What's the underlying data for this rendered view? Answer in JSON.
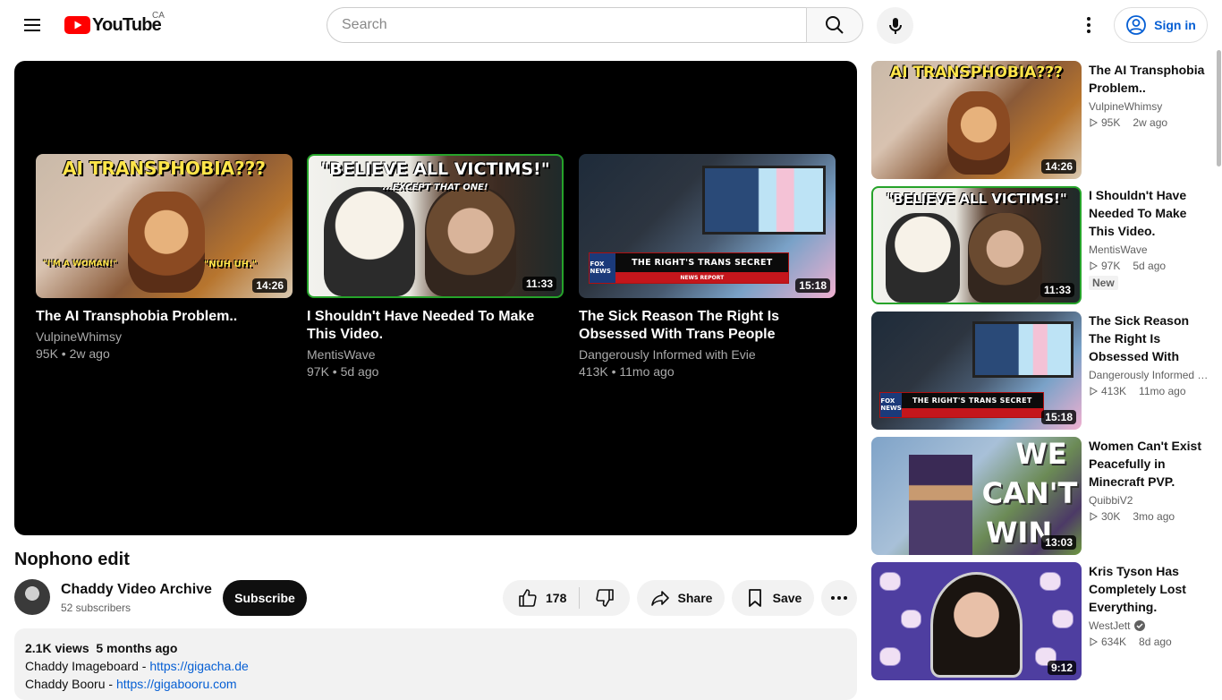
{
  "header": {
    "logo_text": "YouTube",
    "country_code": "CA",
    "search_placeholder": "Search",
    "signin_label": "Sign in",
    "brand_color": "#ff0000"
  },
  "player": {
    "end_cards": [
      {
        "title": "The AI Transphobia Problem..",
        "channel": "VulpineWhimsy",
        "meta": "95K • 2w ago",
        "duration": "14:26",
        "thumb_text_top": "AI TRANSPHOBIA???",
        "thumb_text_left": "\"I'M A WOMAN!\"",
        "thumb_text_right": "\"NUH UH.\""
      },
      {
        "title": "I Shouldn't Have Needed To Make This Video.",
        "channel": "MentisWave",
        "meta": "97K • 5d ago",
        "duration": "11:33",
        "thumb_text_top": "\"BELIEVE ALL VICTIMS!\"",
        "thumb_text_sub": "...EXCEPT THAT ONE!"
      },
      {
        "title": "The Sick Reason The Right Is Obsessed With Trans People",
        "channel": "Dangerously Informed with Evie",
        "meta": "413K • 11mo ago",
        "duration": "15:18",
        "thumb_banner": "THE RIGHT'S TRANS SECRET",
        "thumb_banner_sub": "NEWS REPORT",
        "thumb_logo": "FOX NEWS"
      }
    ]
  },
  "video": {
    "title": "Nophono edit",
    "channel_name": "Chaddy Video Archive",
    "subscribers": "52 subscribers",
    "subscribe_label": "Subscribe",
    "likes": "178",
    "share_label": "Share",
    "save_label": "Save"
  },
  "description": {
    "stats": "2.1K views  5 months ago",
    "lines": [
      {
        "label": "Chaddy Imageboard - ",
        "link": "https://gigacha.de"
      },
      {
        "label": "Chaddy Booru - ",
        "link": "https://gigabooru.com"
      }
    ]
  },
  "recommendations": [
    {
      "title": "The AI Transphobia Problem..",
      "channel": "VulpineWhimsy",
      "views": "95K",
      "age": "2w ago",
      "duration": "14:26",
      "verified": false,
      "badge": ""
    },
    {
      "title": "I Shouldn't Have Needed To Make This Video.",
      "channel": "MentisWave",
      "views": "97K",
      "age": "5d ago",
      "duration": "11:33",
      "verified": false,
      "badge": "New"
    },
    {
      "title": "The Sick Reason The Right Is Obsessed With Trans People",
      "channel": "Dangerously Informed …",
      "views": "413K",
      "age": "11mo ago",
      "duration": "15:18",
      "verified": false,
      "badge": ""
    },
    {
      "title": "Women Can't Exist Peacefully in Minecraft PVP.",
      "channel": "QuibbiV2",
      "views": "30K",
      "age": "3mo ago",
      "duration": "13:03",
      "verified": false,
      "badge": "",
      "thumb_text": [
        "WE",
        "CAN'T",
        "WIN"
      ]
    },
    {
      "title": "Kris Tyson Has Completely Lost Everything.",
      "channel": "WestJett",
      "views": "634K",
      "age": "8d ago",
      "duration": "9:12",
      "verified": true,
      "badge": ""
    }
  ]
}
